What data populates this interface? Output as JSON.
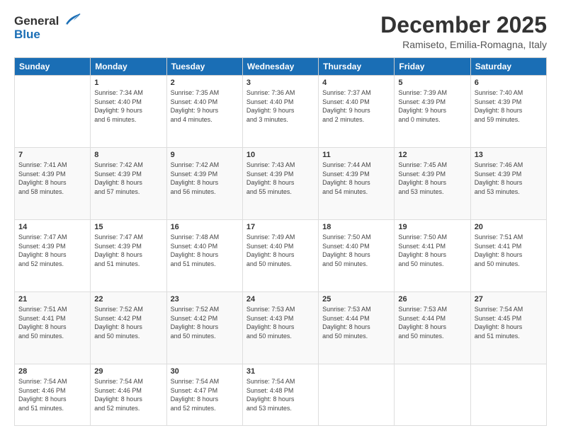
{
  "header": {
    "logo_line1": "General",
    "logo_line2": "Blue",
    "month": "December 2025",
    "location": "Ramiseto, Emilia-Romagna, Italy"
  },
  "weekdays": [
    "Sunday",
    "Monday",
    "Tuesday",
    "Wednesday",
    "Thursday",
    "Friday",
    "Saturday"
  ],
  "weeks": [
    [
      {
        "day": "",
        "info": ""
      },
      {
        "day": "1",
        "info": "Sunrise: 7:34 AM\nSunset: 4:40 PM\nDaylight: 9 hours\nand 6 minutes."
      },
      {
        "day": "2",
        "info": "Sunrise: 7:35 AM\nSunset: 4:40 PM\nDaylight: 9 hours\nand 4 minutes."
      },
      {
        "day": "3",
        "info": "Sunrise: 7:36 AM\nSunset: 4:40 PM\nDaylight: 9 hours\nand 3 minutes."
      },
      {
        "day": "4",
        "info": "Sunrise: 7:37 AM\nSunset: 4:40 PM\nDaylight: 9 hours\nand 2 minutes."
      },
      {
        "day": "5",
        "info": "Sunrise: 7:39 AM\nSunset: 4:39 PM\nDaylight: 9 hours\nand 0 minutes."
      },
      {
        "day": "6",
        "info": "Sunrise: 7:40 AM\nSunset: 4:39 PM\nDaylight: 8 hours\nand 59 minutes."
      }
    ],
    [
      {
        "day": "7",
        "info": "Sunrise: 7:41 AM\nSunset: 4:39 PM\nDaylight: 8 hours\nand 58 minutes."
      },
      {
        "day": "8",
        "info": "Sunrise: 7:42 AM\nSunset: 4:39 PM\nDaylight: 8 hours\nand 57 minutes."
      },
      {
        "day": "9",
        "info": "Sunrise: 7:42 AM\nSunset: 4:39 PM\nDaylight: 8 hours\nand 56 minutes."
      },
      {
        "day": "10",
        "info": "Sunrise: 7:43 AM\nSunset: 4:39 PM\nDaylight: 8 hours\nand 55 minutes."
      },
      {
        "day": "11",
        "info": "Sunrise: 7:44 AM\nSunset: 4:39 PM\nDaylight: 8 hours\nand 54 minutes."
      },
      {
        "day": "12",
        "info": "Sunrise: 7:45 AM\nSunset: 4:39 PM\nDaylight: 8 hours\nand 53 minutes."
      },
      {
        "day": "13",
        "info": "Sunrise: 7:46 AM\nSunset: 4:39 PM\nDaylight: 8 hours\nand 53 minutes."
      }
    ],
    [
      {
        "day": "14",
        "info": "Sunrise: 7:47 AM\nSunset: 4:39 PM\nDaylight: 8 hours\nand 52 minutes."
      },
      {
        "day": "15",
        "info": "Sunrise: 7:47 AM\nSunset: 4:39 PM\nDaylight: 8 hours\nand 51 minutes."
      },
      {
        "day": "16",
        "info": "Sunrise: 7:48 AM\nSunset: 4:40 PM\nDaylight: 8 hours\nand 51 minutes."
      },
      {
        "day": "17",
        "info": "Sunrise: 7:49 AM\nSunset: 4:40 PM\nDaylight: 8 hours\nand 50 minutes."
      },
      {
        "day": "18",
        "info": "Sunrise: 7:50 AM\nSunset: 4:40 PM\nDaylight: 8 hours\nand 50 minutes."
      },
      {
        "day": "19",
        "info": "Sunrise: 7:50 AM\nSunset: 4:41 PM\nDaylight: 8 hours\nand 50 minutes."
      },
      {
        "day": "20",
        "info": "Sunrise: 7:51 AM\nSunset: 4:41 PM\nDaylight: 8 hours\nand 50 minutes."
      }
    ],
    [
      {
        "day": "21",
        "info": "Sunrise: 7:51 AM\nSunset: 4:41 PM\nDaylight: 8 hours\nand 50 minutes."
      },
      {
        "day": "22",
        "info": "Sunrise: 7:52 AM\nSunset: 4:42 PM\nDaylight: 8 hours\nand 50 minutes."
      },
      {
        "day": "23",
        "info": "Sunrise: 7:52 AM\nSunset: 4:42 PM\nDaylight: 8 hours\nand 50 minutes."
      },
      {
        "day": "24",
        "info": "Sunrise: 7:53 AM\nSunset: 4:43 PM\nDaylight: 8 hours\nand 50 minutes."
      },
      {
        "day": "25",
        "info": "Sunrise: 7:53 AM\nSunset: 4:44 PM\nDaylight: 8 hours\nand 50 minutes."
      },
      {
        "day": "26",
        "info": "Sunrise: 7:53 AM\nSunset: 4:44 PM\nDaylight: 8 hours\nand 50 minutes."
      },
      {
        "day": "27",
        "info": "Sunrise: 7:54 AM\nSunset: 4:45 PM\nDaylight: 8 hours\nand 51 minutes."
      }
    ],
    [
      {
        "day": "28",
        "info": "Sunrise: 7:54 AM\nSunset: 4:46 PM\nDaylight: 8 hours\nand 51 minutes."
      },
      {
        "day": "29",
        "info": "Sunrise: 7:54 AM\nSunset: 4:46 PM\nDaylight: 8 hours\nand 52 minutes."
      },
      {
        "day": "30",
        "info": "Sunrise: 7:54 AM\nSunset: 4:47 PM\nDaylight: 8 hours\nand 52 minutes."
      },
      {
        "day": "31",
        "info": "Sunrise: 7:54 AM\nSunset: 4:48 PM\nDaylight: 8 hours\nand 53 minutes."
      },
      {
        "day": "",
        "info": ""
      },
      {
        "day": "",
        "info": ""
      },
      {
        "day": "",
        "info": ""
      }
    ]
  ]
}
